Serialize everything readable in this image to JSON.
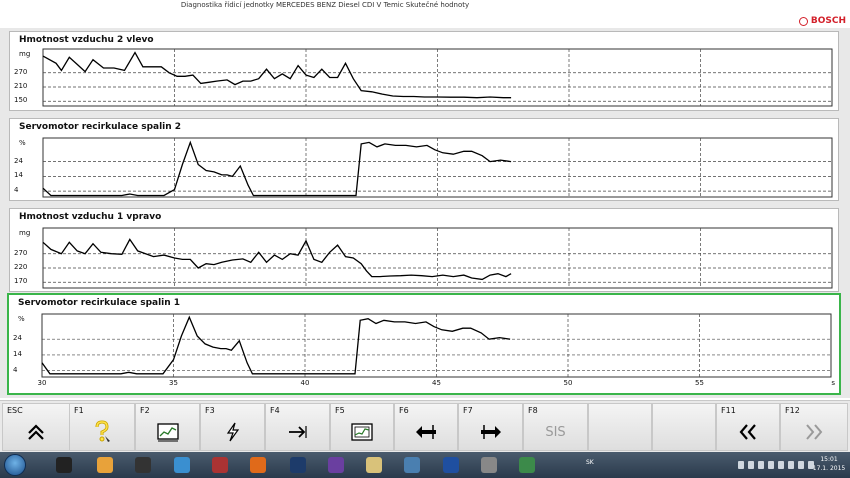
{
  "window": {
    "title": "Diagnostika řídicí jednotky MERCEDES BENZ Diesel CDI V Temic Skutečné hodnoty",
    "brand": "BOSCH"
  },
  "charts": [
    {
      "title": "Hmotnost vzduchu 2 vlevo",
      "unit": "mg",
      "ticks": [
        "270",
        "210",
        "150"
      ],
      "selected": false
    },
    {
      "title": "Servomotor recirkulace spalin 2",
      "unit": "%",
      "ticks": [
        "24",
        "14",
        "4"
      ],
      "selected": false
    },
    {
      "title": "Hmotnost vzduchu 1 vpravo",
      "unit": "mg",
      "ticks": [
        "270",
        "220",
        "170"
      ],
      "selected": false
    },
    {
      "title": "Servomotor recirkulace spalin 1",
      "unit": "%",
      "ticks": [
        "24",
        "14",
        "4"
      ],
      "selected": true
    }
  ],
  "x_axis": {
    "ticks": [
      "30",
      "35",
      "40",
      "45",
      "50",
      "55"
    ],
    "unit": "s"
  },
  "chart_data": [
    {
      "type": "line",
      "title": "Hmotnost vzduchu 2 vlevo",
      "ylabel": "mg",
      "xlim": [
        30,
        60
      ],
      "ylim": [
        130,
        370
      ],
      "grid": true,
      "x": [
        30,
        30.5,
        30.7,
        31,
        31.3,
        31.6,
        31.9,
        32.3,
        32.7,
        33.1,
        33.5,
        33.8,
        34.2,
        34.5,
        34.8,
        35.1,
        35.4,
        35.7,
        36,
        36.3,
        36.6,
        37,
        37.3,
        37.6,
        37.9,
        38.2,
        38.5,
        38.8,
        39.1,
        39.4,
        39.7,
        40,
        40.3,
        40.6,
        40.9,
        41.2,
        41.5,
        41.8,
        42.1,
        42.5,
        42.9,
        43.3,
        43.7,
        44.1,
        44.5,
        45,
        45.5,
        46,
        46.5,
        47,
        47.5,
        47.8
      ],
      "y": [
        340,
        310,
        280,
        335,
        305,
        275,
        325,
        290,
        290,
        280,
        355,
        295,
        295,
        295,
        270,
        255,
        255,
        260,
        225,
        230,
        235,
        240,
        220,
        235,
        235,
        245,
        285,
        245,
        265,
        245,
        300,
        260,
        250,
        285,
        250,
        250,
        310,
        245,
        195,
        190,
        180,
        172,
        170,
        170,
        168,
        168,
        167,
        167,
        165,
        168,
        165,
        165
      ]
    },
    {
      "type": "line",
      "title": "Servomotor recirkulace spalin 2",
      "ylabel": "%",
      "xlim": [
        30,
        60
      ],
      "ylim": [
        0,
        40
      ],
      "grid": true,
      "x": [
        30,
        30.3,
        30.6,
        31,
        32,
        33,
        33.3,
        33.6,
        34,
        34.6,
        35,
        35.3,
        35.6,
        35.9,
        36.2,
        36.5,
        36.8,
        37,
        37.2,
        37.5,
        37.8,
        38,
        39,
        40,
        41,
        41.5,
        41.9,
        42.1,
        42.4,
        42.7,
        43,
        43.4,
        43.8,
        44.2,
        44.6,
        44.9,
        45.2,
        45.6,
        46,
        46.3,
        46.7,
        47,
        47.4,
        47.8
      ],
      "y": [
        6,
        1,
        1,
        1,
        1,
        1,
        2,
        1,
        1,
        1,
        5,
        22,
        37,
        22,
        18,
        17,
        15,
        15,
        14,
        21,
        8,
        1,
        1,
        1,
        1,
        1,
        1,
        36,
        37,
        34,
        36,
        35,
        35,
        34,
        35,
        32,
        30,
        29,
        31,
        31,
        28,
        24,
        25,
        24
      ]
    },
    {
      "type": "line",
      "title": "Hmotnost vzduchu 1 vpravo",
      "ylabel": "mg",
      "xlim": [
        30,
        60
      ],
      "ylim": [
        150,
        360
      ],
      "grid": true,
      "x": [
        30,
        30.3,
        30.7,
        31,
        31.3,
        31.6,
        31.9,
        32.2,
        32.6,
        33,
        33.3,
        33.6,
        33.9,
        34.2,
        34.6,
        35,
        35.3,
        35.6,
        35.9,
        36.2,
        36.5,
        36.8,
        37.2,
        37.6,
        37.9,
        38.2,
        38.5,
        38.8,
        39.1,
        39.4,
        39.7,
        40,
        40.3,
        40.6,
        40.9,
        41.2,
        41.5,
        41.8,
        42.1,
        42.3,
        42.5,
        42.8,
        43.2,
        43.6,
        44,
        44.4,
        44.8,
        45.2,
        45.6,
        46,
        46.3,
        46.7,
        47,
        47.3,
        47.6,
        47.8
      ],
      "y": [
        310,
        285,
        270,
        310,
        280,
        270,
        305,
        275,
        270,
        268,
        320,
        280,
        270,
        260,
        265,
        255,
        250,
        250,
        220,
        235,
        232,
        240,
        248,
        252,
        240,
        275,
        240,
        265,
        250,
        270,
        265,
        315,
        250,
        240,
        275,
        300,
        260,
        255,
        235,
        210,
        190,
        190,
        192,
        193,
        195,
        193,
        190,
        195,
        190,
        195,
        185,
        180,
        195,
        200,
        190,
        200
      ]
    },
    {
      "type": "line",
      "title": "Servomotor recirkulace spalin 1",
      "ylabel": "%",
      "xlim": [
        30,
        60
      ],
      "ylim": [
        0,
        40
      ],
      "grid": true,
      "x": [
        30,
        30.3,
        30.6,
        31,
        32,
        33,
        33.3,
        33.6,
        34,
        34.6,
        35,
        35.3,
        35.6,
        35.9,
        36.2,
        36.5,
        36.8,
        37,
        37.2,
        37.5,
        37.8,
        38,
        39,
        40,
        41,
        41.5,
        41.9,
        42.1,
        42.4,
        42.7,
        43,
        43.4,
        43.8,
        44.2,
        44.6,
        44.9,
        45.2,
        45.6,
        46,
        46.3,
        46.7,
        47,
        47.4,
        47.8
      ],
      "y": [
        9,
        2,
        2,
        2,
        2,
        2,
        3,
        2,
        2,
        2,
        11,
        26,
        38,
        26,
        21,
        19,
        18,
        18,
        17,
        23,
        9,
        2,
        2,
        2,
        2,
        2,
        2,
        36,
        37,
        34,
        36,
        35,
        35,
        34,
        35,
        32,
        30,
        29,
        31,
        31,
        28,
        24,
        25,
        24
      ]
    }
  ],
  "function_keys": [
    {
      "key": "ESC",
      "icon": "up-chevrons-icon"
    },
    {
      "key": "F1",
      "icon": "help-icon"
    },
    {
      "key": "F2",
      "icon": "chart-icon"
    },
    {
      "key": "F3",
      "icon": "lightning-icon"
    },
    {
      "key": "F4",
      "icon": "enter-arrow-icon"
    },
    {
      "key": "F5",
      "icon": "graph-frame-icon"
    },
    {
      "key": "F6",
      "icon": "arrow-left-bar-icon"
    },
    {
      "key": "F7",
      "icon": "arrow-right-bar-icon"
    },
    {
      "key": "F8",
      "text": "SIS"
    },
    {
      "key": ""
    },
    {
      "key": ""
    },
    {
      "key": "F11",
      "icon": "double-chevron-left-icon"
    },
    {
      "key": "F12",
      "icon": "double-chevron-right-icon"
    }
  ],
  "taskbar": {
    "language": "SK",
    "time": "15:01",
    "date": "17.1. 2015",
    "apps": [
      "bosch-app",
      "chrome",
      "media",
      "vs-app",
      "game",
      "firefox",
      "photoshop",
      "visual-studio",
      "explorer",
      "photo",
      "vis",
      "disc",
      "esi"
    ]
  },
  "colors": {
    "selection": "#3ab54a",
    "brand": "#d3202a",
    "grid": "#444444"
  }
}
